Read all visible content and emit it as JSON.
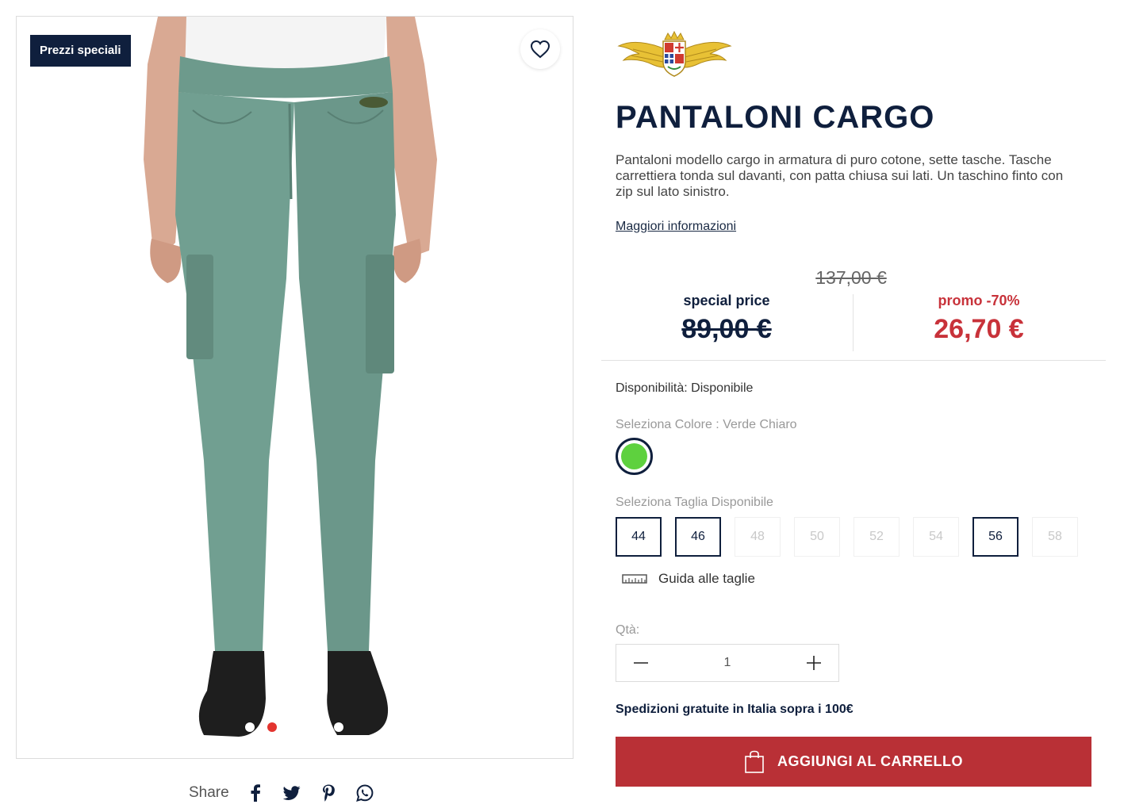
{
  "gallery": {
    "badge": "Prezzi speciali",
    "wishlist_icon": "heart-icon",
    "slides_count": 3,
    "active_slide": 2
  },
  "share": {
    "label": "Share",
    "icons": [
      "facebook-icon",
      "twitter-icon",
      "pinterest-icon",
      "whatsapp-icon"
    ]
  },
  "product": {
    "title": "PANTALONI CARGO",
    "description": "Pantaloni modello cargo in armatura di puro cotone, sette tasche. Tasche carrettiera tonda sul davanti, con patta chiusa sui lati. Un taschino finto con zip sul lato sinistro.",
    "more_info": "Maggiori informazioni",
    "original_price": "137,00 €",
    "special_label": "special price",
    "special_price": "89,00 €",
    "promo_label": "promo -70%",
    "promo_price": "26,70 €",
    "availability": "Disponibilità: Disponibile",
    "color_label": "Seleziona Colore : Verde Chiaro",
    "size_label": "Seleziona Taglia Disponibile",
    "sizes": [
      {
        "label": "44",
        "available": true
      },
      {
        "label": "46",
        "available": true
      },
      {
        "label": "48",
        "available": false
      },
      {
        "label": "50",
        "available": false
      },
      {
        "label": "52",
        "available": false
      },
      {
        "label": "54",
        "available": false
      },
      {
        "label": "56",
        "available": true
      },
      {
        "label": "58",
        "available": false
      }
    ],
    "size_guide": "Guida alle taglie",
    "qty_label": "Qtà:",
    "qty_value": "1",
    "shipping": "Spedizioni gratuite in Italia sopra i 100€",
    "add_to_cart": "AGGIUNGI AL CARRELLO"
  },
  "colors": {
    "navy": "#0f1f3d",
    "promo_red": "#c8323a",
    "cart_red": "#b93036",
    "swatch_green": "#5ed13e",
    "pants_green": "#6f9b8e"
  }
}
